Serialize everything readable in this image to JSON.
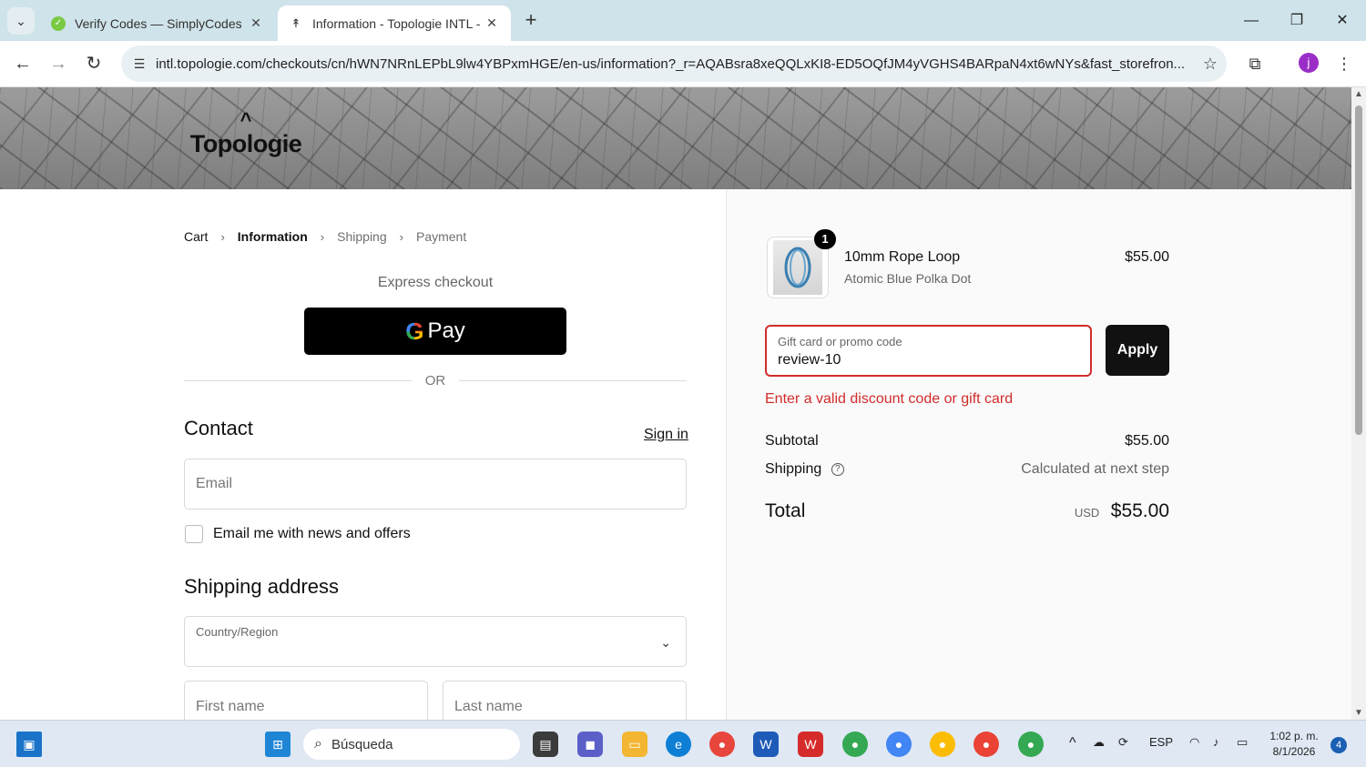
{
  "browser": {
    "tabs": [
      {
        "title": "Verify Codes — SimplyCodes",
        "active": false
      },
      {
        "title": "Information - Topologie INTL - ",
        "active": true
      }
    ],
    "url": "intl.topologie.com/checkouts/cn/hWN7NRnLEPbL9lw4YBPxmHGE/en-us/information?_r=AQABsra8xeQQLxKI8-ED5OQfJM4yVGHS4BARpaN4xt6wNYs&fast_storefron...",
    "profile_initial": "j"
  },
  "header": {
    "brand": "Topologie"
  },
  "breadcrumb": {
    "cart": "Cart",
    "information": "Information",
    "shipping": "Shipping",
    "payment": "Payment",
    "sep": "›"
  },
  "express": {
    "title": "Express checkout",
    "gpay_label": "Pay",
    "or_label": "OR"
  },
  "contact": {
    "heading": "Contact",
    "signin": "Sign in",
    "email_placeholder": "Email",
    "newsletter_label": "Email me with news and offers"
  },
  "shipping_address": {
    "heading": "Shipping address",
    "country_label": "Country/Region",
    "first_name_placeholder": "First name",
    "last_name_placeholder": "Last name"
  },
  "order": {
    "item": {
      "name": "10mm Rope Loop",
      "variant": "Atomic Blue Polka Dot",
      "price": "$55.00",
      "quantity": "1"
    },
    "promo": {
      "label": "Gift card or promo code",
      "value": "review-10",
      "apply": "Apply",
      "error": "Enter a valid discount code or gift card"
    },
    "subtotal_label": "Subtotal",
    "subtotal": "$55.00",
    "shipping_label": "Shipping",
    "shipping_value": "Calculated at next step",
    "total_label": "Total",
    "currency": "USD",
    "total": "$55.00"
  },
  "taskbar": {
    "search_placeholder": "Búsqueda",
    "lang": "ESP",
    "time": "1:02 p. m.",
    "date": "8/1/2026",
    "notifications": "4"
  },
  "colors": {
    "error": "#d12c2c",
    "button": "#111111",
    "tab_bar": "#cfe3ea"
  }
}
